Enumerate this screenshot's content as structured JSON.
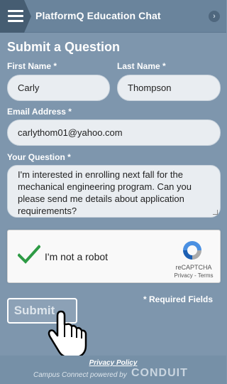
{
  "header": {
    "title": "PlatformQ Education Chat",
    "menu_icon": "hamburger-menu-icon",
    "collapse_icon": "chevron-right-circle-icon"
  },
  "form": {
    "title": "Submit a Question",
    "first_name": {
      "label": "First Name *",
      "value": "Carly"
    },
    "last_name": {
      "label": "Last Name *",
      "value": "Thompson"
    },
    "email": {
      "label": "Email Address *",
      "value": "carlythom01@yahoo.com"
    },
    "question": {
      "label": "Your Question *",
      "value": "I'm interested in enrolling next fall for the mechanical engineering program. Can you please send me details about application requirements?"
    },
    "required_note": "* Required Fields",
    "submit_label": "Submit"
  },
  "captcha": {
    "label": "I'm not a robot",
    "brand": "reCAPTCHA",
    "links": "Privacy - Terms",
    "checked": true
  },
  "footer": {
    "privacy_link": "Privacy Policy",
    "powered_by": "Campus Connect powered by",
    "logo_text": "CONDUIT"
  },
  "colors": {
    "background": "#7e96ad",
    "header": "#6a849c",
    "menu_tab": "#465d72",
    "field_bg": "#e9edf1",
    "check_green": "#2e9b45"
  }
}
